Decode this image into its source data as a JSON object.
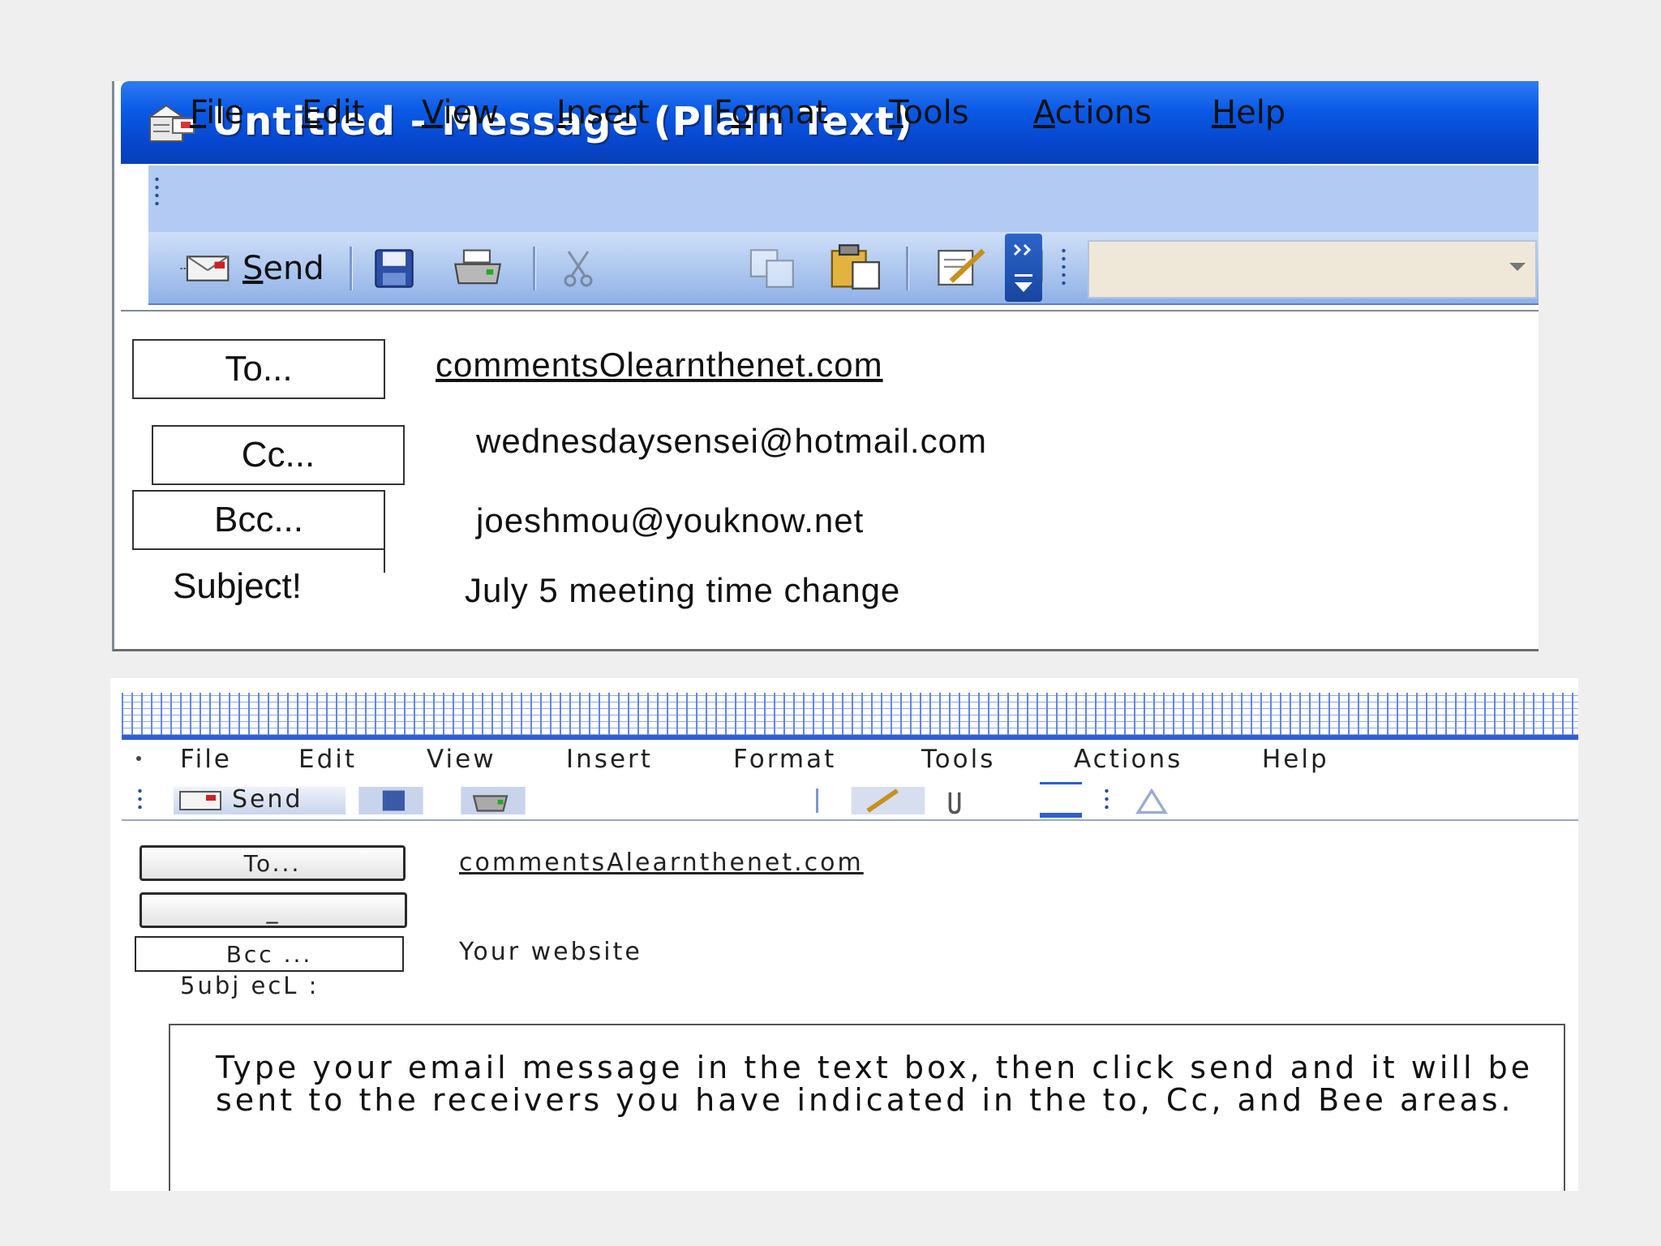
{
  "window1": {
    "title": "Untitled - Message (Plain Text)",
    "menu": [
      {
        "label": "File",
        "key": "F",
        "rest": "ile"
      },
      {
        "label": "Edit",
        "key": "E",
        "rest": "dit"
      },
      {
        "label": "View",
        "key": "V",
        "rest": "iew"
      },
      {
        "label": "Insert",
        "key": "I",
        "rest": "nsert"
      },
      {
        "label": "Format",
        "pre": "F",
        "key": "o",
        "rest": "rmat"
      },
      {
        "label": "Tools",
        "key": "T",
        "rest": "ools"
      },
      {
        "label": "Actions",
        "key": "A",
        "rest": "ctions"
      },
      {
        "label": "Help",
        "key": "H",
        "rest": "elp"
      }
    ],
    "send_label": "Send",
    "send_key": "S",
    "send_rest": "end",
    "to_button": "To...",
    "cc_button": "Cc...",
    "bcc_button": "Bcc...",
    "subject_label": "Subject!",
    "to_value": "commentsOlearnthenet.com",
    "cc_value": "wednesdaysensei@hotmail.com",
    "bcc_value": "joeshmou@youknow.net",
    "subject_value": "July 5 meeting time change",
    "combo_value": ""
  },
  "window2": {
    "menu": [
      "File",
      "Edit",
      "View",
      "Insert",
      "Format",
      "Tools",
      "Actions",
      "Help"
    ],
    "send_label": "Send",
    "to_button": "To...",
    "cc_button": "_",
    "bcc_button": "Bcc ...",
    "subject_label": "5ubj ecL :",
    "to_value": "commentsAlearnthenet.com",
    "bcc_value": "Your website",
    "body_text": "Type your email message in the text box, then click send and it will be sent to the receivers you have indicated in the to, Cc, and Bee areas."
  },
  "icons": [
    "envelope-icon",
    "send-icon",
    "save-icon",
    "print-icon",
    "cut-icon",
    "copy-icon",
    "paste-icon",
    "signature-icon",
    "paperclip-icon",
    "toolbar-options-icon",
    "dropdown-arrow-icon"
  ]
}
